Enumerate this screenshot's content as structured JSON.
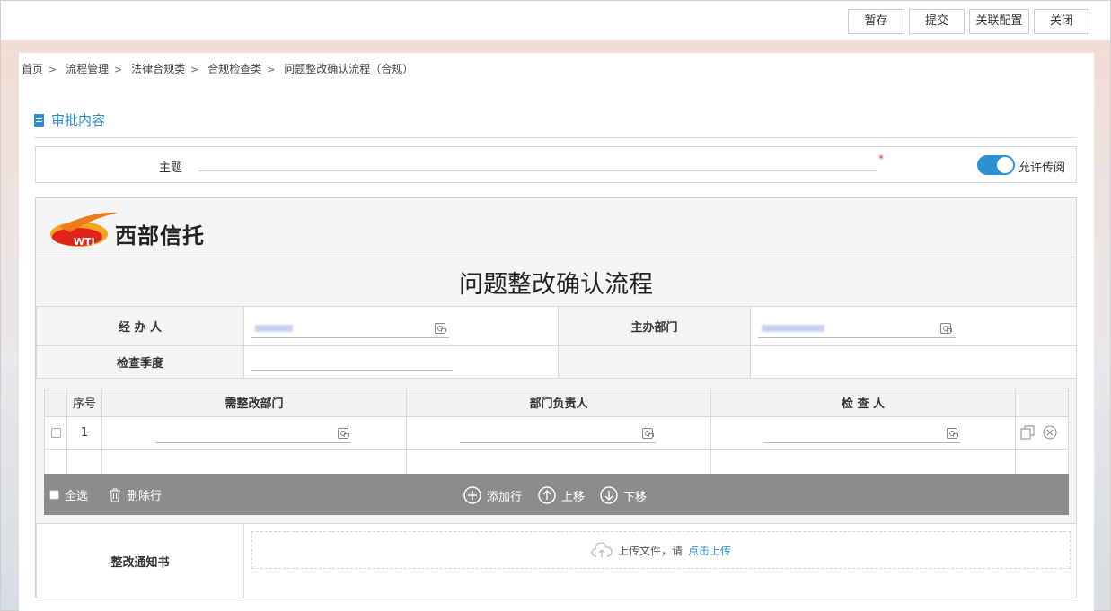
{
  "toolbar": {
    "save_draft": "暂存",
    "submit": "提交",
    "link_config": "关联配置",
    "close": "关闭"
  },
  "breadcrumb": [
    "首页",
    "流程管理",
    "法律合规类",
    "合规检查类",
    "问题整改确认流程（合规）"
  ],
  "section_title": "审批内容",
  "subject": {
    "label": "主题",
    "value": "",
    "required_mark": "*",
    "allow_forward_label": "允许传阅",
    "allow_forward": true
  },
  "logo": {
    "text": "西部信托",
    "mark_text": "WTI"
  },
  "form": {
    "title": "问题整改确认流程",
    "handler_label": "经 办 人",
    "handler_value": "",
    "dept_label": "主办部门",
    "dept_value": "",
    "quarter_label": "检查季度",
    "quarter_value": ""
  },
  "table": {
    "headers": [
      "序号",
      "需整改部门",
      "部门负责人",
      "检 查 人"
    ],
    "rows": [
      {
        "index": "1",
        "dept": "",
        "head": "",
        "inspector": ""
      }
    ],
    "select_all": "全选",
    "delete_row": "删除行",
    "add_row": "添加行",
    "move_up": "上移",
    "move_down": "下移"
  },
  "notice": {
    "label": "整改通知书",
    "upload_text": "上传文件，请",
    "upload_link": "点击上传"
  },
  "colors": {
    "accent": "#2b8fd0",
    "bar": "#8c8c8c",
    "required": "#e33333"
  }
}
